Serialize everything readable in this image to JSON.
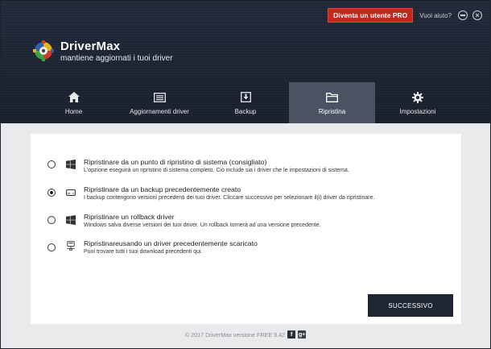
{
  "topbar": {
    "pro_label": "Diventa un utente PRO",
    "help_label": "Vuoi aiuto?"
  },
  "brand": {
    "name": "DriverMax",
    "tagline": "mantiene aggiornati i tuoi driver"
  },
  "nav": {
    "tabs": [
      {
        "label": "Home",
        "icon": "home-icon"
      },
      {
        "label": "Aggiornamenti driver",
        "icon": "list-icon"
      },
      {
        "label": "Backup",
        "icon": "download-icon"
      },
      {
        "label": "Ripristina",
        "icon": "folder-icon",
        "active": true
      },
      {
        "label": "Impostazioni",
        "icon": "gear-icon"
      }
    ]
  },
  "options": [
    {
      "title": "Ripristinare da un punto di ripristino di sistema (consigliato)",
      "desc": "L'opzione eseguirà un ripristino di sistema completo. Ciò include sia i driver che le impostazioni di sistema.",
      "icon": "windows-icon",
      "checked": false
    },
    {
      "title": "Ripristinare da un backup precedentemente creato",
      "desc": "I backup contengono versioni precedenti dei tuoi driver. Cliccare successivo per selezionare il(i) driver da ripristinare.",
      "icon": "hard-drive-icon",
      "checked": true
    },
    {
      "title": "Ripristinare un rollback driver",
      "desc": "Windows salva diverse versioni dei tuoi driver. Un rollback tornerà ad una versione precedente.",
      "icon": "windows-icon",
      "checked": false
    },
    {
      "title": "Ripristinareusando un driver precedentemente scaricato",
      "desc": "Puoi trovare tutti i tuoi download precedenti qui.",
      "icon": "network-drive-icon",
      "checked": false
    }
  ],
  "next_label": "SUCCESSIVO",
  "footer": {
    "text": "© 2017 DriverMax versione FREE 9.42",
    "facebook": "f",
    "google": "g+"
  },
  "colors": {
    "header_bg": "#1c2331",
    "active_tab": "#4b5363",
    "pro_red": "#c8261d",
    "button_dark": "#1e2533"
  }
}
